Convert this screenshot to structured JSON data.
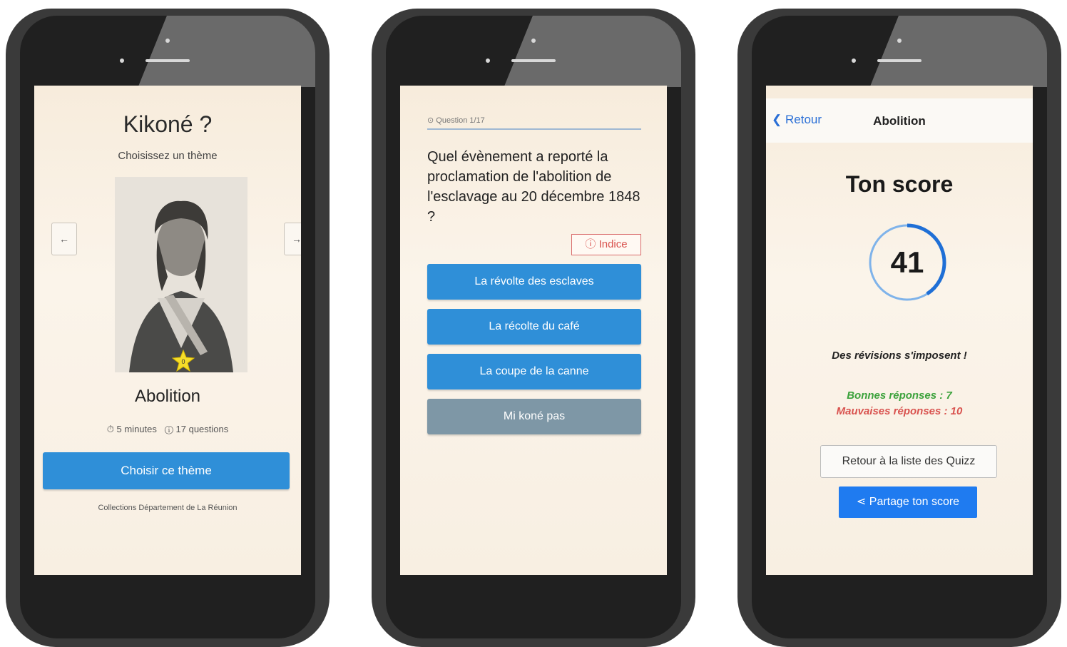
{
  "screen1": {
    "title": "Kikoné ?",
    "subtitle": "Choisissez un thème",
    "prev_arrow": "←",
    "next_arrow": "→",
    "star_count": "0",
    "theme_name": "Abolition",
    "duration": "5 minutes",
    "questions": "17 questions",
    "choose_button": "Choisir ce thème",
    "credit": "Collections Département de La Réunion"
  },
  "screen2": {
    "question_label": "Question 1/17",
    "question": "Quel évènement a reporté la proclamation de l'abolition de l'esclavage au 20 décembre 1848 ?",
    "hint_label": "Indice",
    "answers": [
      {
        "label": "La révolte des esclaves"
      },
      {
        "label": "La récolte du café"
      },
      {
        "label": "La coupe de la canne"
      },
      {
        "label": "Mi koné pas"
      }
    ]
  },
  "screen3": {
    "back_label": "Retour",
    "nav_title": "Abolition",
    "score_title": "Ton score",
    "score_value": "41",
    "score_fraction": 0.41,
    "message": "Des révisions s'imposent !",
    "good_answers": "Bonnes réponses : 7",
    "bad_answers": "Mauvaises réponses : 10",
    "list_button": "Retour à la liste des Quizz",
    "share_button": "Partage ton score"
  },
  "colors": {
    "primary_blue": "#2f8fd8",
    "grey_button": "#7e97a6",
    "good": "#3ca23c",
    "bad": "#d9534f",
    "share_blue": "#1f7bf0"
  }
}
